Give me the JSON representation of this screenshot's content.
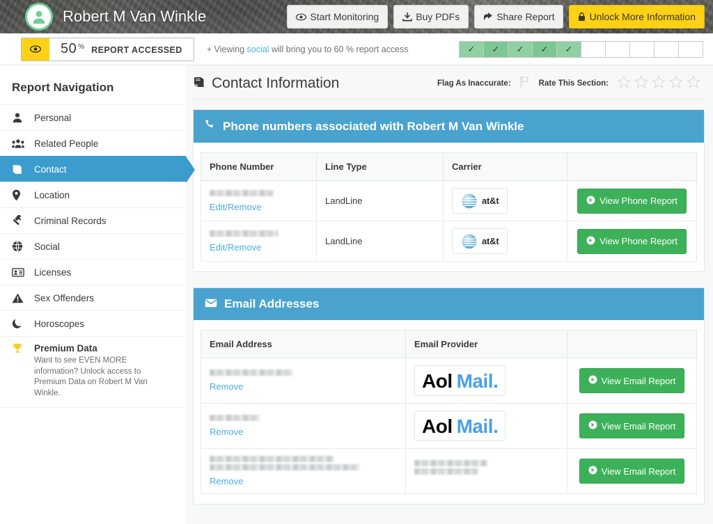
{
  "hero": {
    "name": "Robert M Van Winkle",
    "avatar_icon": "user-avatar-icon",
    "buttons": [
      {
        "label": "Start Monitoring",
        "icon": "eye-icon",
        "style": "light"
      },
      {
        "label": "Buy PDFs",
        "icon": "download-icon",
        "style": "light"
      },
      {
        "label": "Share Report",
        "icon": "share-icon",
        "style": "light"
      },
      {
        "label": "Unlock More Information",
        "icon": "lock-icon",
        "style": "gold"
      }
    ]
  },
  "access": {
    "eye_icon": "eye-icon",
    "percent": "50",
    "percent_symbol": "%",
    "label": "REPORT ACCESSED",
    "note_prefix": "+ Viewing ",
    "note_link": "social",
    "note_suffix": " will bring you to 60 % report access",
    "steps_total": 10,
    "steps_done": 5,
    "step_check": "✓",
    "accent_yellow": "#fcd116",
    "accent_green": "#7cc894"
  },
  "sidebar": {
    "title": "Report Navigation",
    "items": [
      {
        "label": "Personal",
        "icon": "person-icon",
        "active": false
      },
      {
        "label": "Related People",
        "icon": "people-icon",
        "active": false
      },
      {
        "label": "Contact",
        "icon": "book-icon",
        "active": true
      },
      {
        "label": "Location",
        "icon": "map-pin-icon",
        "active": false
      },
      {
        "label": "Criminal Records",
        "icon": "gavel-icon",
        "active": false
      },
      {
        "label": "Social",
        "icon": "globe-icon",
        "active": false
      },
      {
        "label": "Licenses",
        "icon": "id-card-icon",
        "active": false
      },
      {
        "label": "Sex Offenders",
        "icon": "warning-icon",
        "active": false
      },
      {
        "label": "Horoscopes",
        "icon": "moon-icon",
        "active": false
      }
    ],
    "premium": {
      "icon": "trophy-icon",
      "title": "Premium Data",
      "description": "Want to see EVEN MORE information? Unlock access to Premium Data on Robert M Van Winkle."
    }
  },
  "section": {
    "icon": "book-icon",
    "title": "Contact Information",
    "flag_label": "Flag As Inaccurate:",
    "flag_icon": "flag-icon",
    "rate_label": "Rate This Section:",
    "stars_total": 5,
    "stars_filled": 0
  },
  "phones": {
    "card_title": "Phone numbers associated with Robert M Van Winkle",
    "card_icon": "phone-icon",
    "columns": [
      "Phone Number",
      "Line Type",
      "Carrier",
      ""
    ],
    "rows": [
      {
        "number": "[redacted]",
        "edit_label": "Edit/Remove",
        "line_type": "LandLine",
        "carrier": "at&t",
        "carrier_icon": "att-logo-icon",
        "action_label": "View Phone Report",
        "action_icon": "arrow-circle-right-icon"
      },
      {
        "number": "[redacted]",
        "edit_label": "Edit/Remove",
        "line_type": "LandLine",
        "carrier": "at&t",
        "carrier_icon": "att-logo-icon",
        "action_label": "View Phone Report",
        "action_icon": "arrow-circle-right-icon"
      }
    ]
  },
  "emails": {
    "card_title": "Email Addresses",
    "card_icon": "envelope-icon",
    "columns": [
      "Email Address",
      "Email Provider",
      ""
    ],
    "aol_part1": "Aol",
    "aol_part2": "Mail.",
    "rows": [
      {
        "address": "[redacted]",
        "remove_label": "Remove",
        "provider": "Aol Mail.",
        "provider_type": "aol",
        "action_label": "View Email Report",
        "action_icon": "arrow-circle-right-icon"
      },
      {
        "address": "[redacted]",
        "remove_label": "Remove",
        "provider": "Aol Mail.",
        "provider_type": "aol",
        "action_label": "View Email Report",
        "action_icon": "arrow-circle-right-icon"
      },
      {
        "address": "[redacted]",
        "remove_label": "Remove",
        "provider": "[redacted]",
        "provider_type": "redacted",
        "action_label": "View Email Report",
        "action_icon": "arrow-circle-right-icon"
      }
    ]
  },
  "colors": {
    "brand_blue": "#4aa3cf",
    "active_blue": "#3b9ccd",
    "link_blue": "#4aaede",
    "green_button": "#3cb159",
    "gold": "#fcd116"
  }
}
